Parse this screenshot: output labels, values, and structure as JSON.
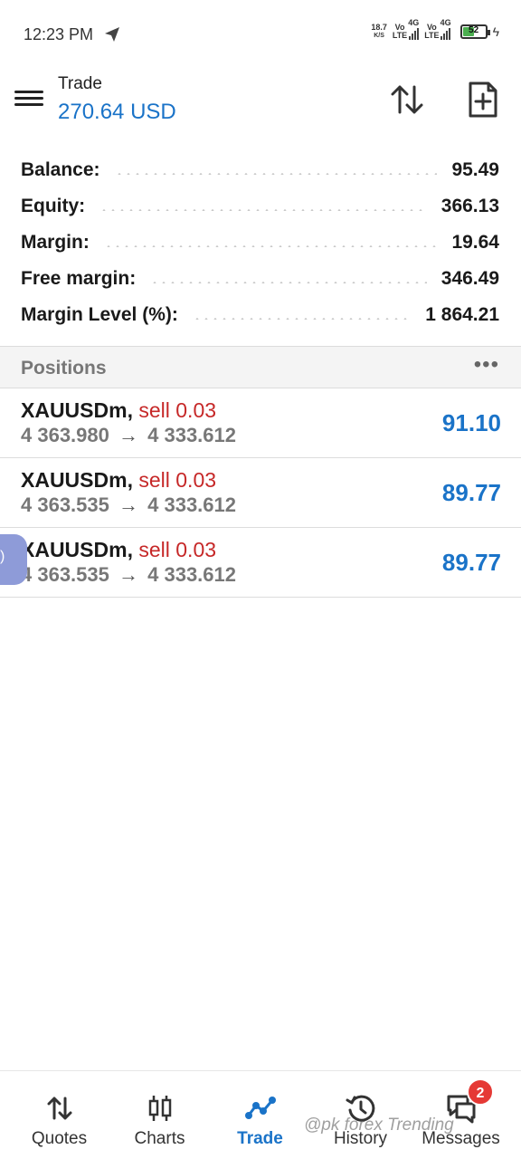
{
  "status_bar": {
    "time": "12:23 PM",
    "net_speed_value": "18.7",
    "net_speed_unit": "K/S",
    "sim1_label_top": "Vo",
    "sim1_label_bottom": "LTE",
    "sim1_type": "4G",
    "sim2_label_top": "Vo",
    "sim2_label_bottom": "LTE",
    "sim2_type": "4G",
    "battery_level": "52",
    "battery_color": "#4caf50"
  },
  "header": {
    "title": "Trade",
    "amount": "270.64 USD",
    "sort_icon": "sort-arrows-icon",
    "new_order_icon": "new-order-icon"
  },
  "summary": [
    {
      "label": "Balance:",
      "value": "95.49"
    },
    {
      "label": "Equity:",
      "value": "366.13"
    },
    {
      "label": "Margin:",
      "value": "19.64"
    },
    {
      "label": "Free margin:",
      "value": "346.49"
    },
    {
      "label": "Margin Level (%):",
      "value": "1 864.21"
    }
  ],
  "positions": {
    "title": "Positions",
    "more": "•••",
    "items": [
      {
        "symbol": "XAUUSDm,",
        "side": "sell 0.03",
        "open": "4 363.980",
        "arrow": "→",
        "current": "4 333.612",
        "profit": "91.10"
      },
      {
        "symbol": "XAUUSDm,",
        "side": "sell 0.03",
        "open": "4 363.535",
        "arrow": "→",
        "current": "4 333.612",
        "profit": "89.77"
      },
      {
        "symbol": "XAUUSDm,",
        "side": "sell 0.03",
        "open": "4 363.535",
        "arrow": "→",
        "current": "4 333.612",
        "profit": "89.77"
      }
    ]
  },
  "bottom_nav": {
    "items": [
      {
        "label": "Quotes",
        "icon": "quotes-icon"
      },
      {
        "label": "Charts",
        "icon": "charts-icon"
      },
      {
        "label": "Trade",
        "icon": "trade-icon"
      },
      {
        "label": "History",
        "icon": "history-icon"
      },
      {
        "label": "Messages",
        "icon": "messages-icon"
      }
    ],
    "active": "Trade",
    "messages_badge": "2"
  },
  "colors": {
    "accent": "#1a73c8",
    "sell": "#c62828"
  },
  "watermark": "@pk forex Trending"
}
